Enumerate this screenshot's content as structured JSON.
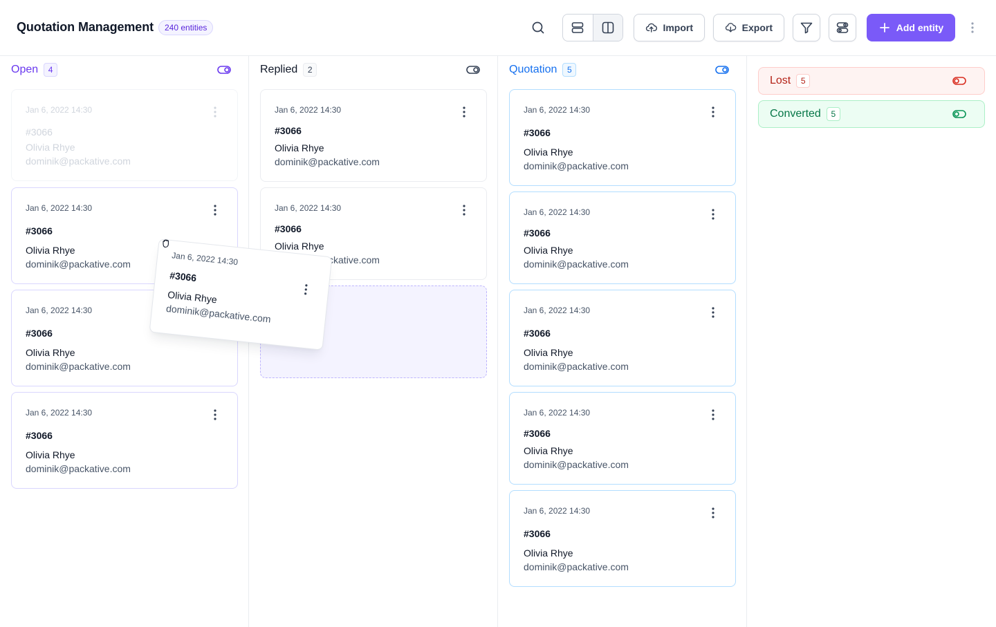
{
  "header": {
    "title": "Quotation Management",
    "entity_count": "240 entities",
    "import_label": "Import",
    "export_label": "Export",
    "add_label": "Add entity"
  },
  "colors": {
    "accent": "#7a5af8",
    "open": "#6938ef",
    "quotation": "#1570ef",
    "lost": "#b42318",
    "converted": "#067647"
  },
  "icons": [
    "search-icon",
    "rows-view-icon",
    "columns-view-icon",
    "upload-cloud-icon",
    "download-cloud-icon",
    "filter-icon",
    "settings-toggle-icon",
    "plus-icon",
    "dots-vertical-icon",
    "toggle-icon",
    "grab-hand-icon"
  ],
  "columns": {
    "open": {
      "name": "Open",
      "count": "4",
      "cards": [
        {
          "date": "Jan 6, 2022 14:30",
          "number": "#3066",
          "name": "Olivia Rhye",
          "email": "dominik@packative.com"
        },
        {
          "date": "Jan 6, 2022 14:30",
          "number": "#3066",
          "name": "Olivia Rhye",
          "email": "dominik@packative.com"
        },
        {
          "date": "Jan 6, 2022 14:30",
          "number": "#3066",
          "name": "Olivia Rhye",
          "email": "dominik@packative.com"
        },
        {
          "date": "Jan 6, 2022 14:30",
          "number": "#3066",
          "name": "Olivia Rhye",
          "email": "dominik@packative.com"
        }
      ]
    },
    "replied": {
      "name": "Replied",
      "count": "2",
      "cards": [
        {
          "date": "Jan 6, 2022 14:30",
          "number": "#3066",
          "name": "Olivia Rhye",
          "email": "dominik@packative.com"
        },
        {
          "date": "Jan 6, 2022 14:30",
          "number": "#3066",
          "name": "Olivia Rhye",
          "email": "dominik@packative.com"
        }
      ]
    },
    "quotation": {
      "name": "Quotation",
      "count": "5",
      "cards": [
        {
          "date": "Jan 6, 2022 14:30",
          "number": "#3066",
          "name": "Olivia Rhye",
          "email": "dominik@packative.com"
        },
        {
          "date": "Jan 6, 2022 14:30",
          "number": "#3066",
          "name": "Olivia Rhye",
          "email": "dominik@packative.com"
        },
        {
          "date": "Jan 6, 2022 14:30",
          "number": "#3066",
          "name": "Olivia Rhye",
          "email": "dominik@packative.com"
        },
        {
          "date": "Jan 6, 2022 14:30",
          "number": "#3066",
          "name": "Olivia Rhye",
          "email": "dominik@packative.com"
        },
        {
          "date": "Jan 6, 2022 14:30",
          "number": "#3066",
          "name": "Olivia Rhye",
          "email": "dominik@packative.com"
        }
      ]
    },
    "lost": {
      "name": "Lost",
      "count": "5"
    },
    "converted": {
      "name": "Converted",
      "count": "5"
    }
  },
  "dragged_card": {
    "date": "Jan 6, 2022 14:30",
    "number": "#3066",
    "name": "Olivia Rhye",
    "email": "dominik@packative.com"
  }
}
